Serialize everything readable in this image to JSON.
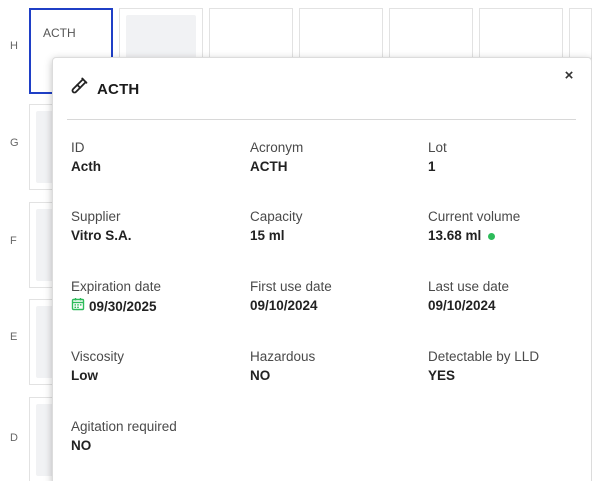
{
  "grid": {
    "row_labels": [
      "H",
      "G",
      "F",
      "E",
      "D"
    ],
    "selected_cell_label": "ACTH"
  },
  "popup": {
    "icon": "test-tube-icon",
    "title": "ACTH",
    "close_label": "×",
    "fields": {
      "id": {
        "label": "ID",
        "value": "Acth"
      },
      "acronym": {
        "label": "Acronym",
        "value": "ACTH"
      },
      "lot": {
        "label": "Lot",
        "value": "1"
      },
      "supplier": {
        "label": "Supplier",
        "value": "Vitro S.A."
      },
      "capacity": {
        "label": "Capacity",
        "value": "15 ml"
      },
      "current_volume": {
        "label": "Current volume",
        "value": "13.68 ml",
        "status_color": "#2dbb5a"
      },
      "expiration_date": {
        "label": "Expiration date",
        "value": "09/30/2025",
        "icon": "calendar-icon",
        "icon_color": "#2dbb5a"
      },
      "first_use_date": {
        "label": "First use date",
        "value": "09/10/2024"
      },
      "last_use_date": {
        "label": "Last use date",
        "value": "09/10/2024"
      },
      "viscosity": {
        "label": "Viscosity",
        "value": "Low"
      },
      "hazardous": {
        "label": "Hazardous",
        "value": "NO"
      },
      "detectable_lld": {
        "label": "Detectable by LLD",
        "value": "YES"
      },
      "agitation_required": {
        "label": "Agitation required",
        "value": "NO"
      }
    }
  },
  "colors": {
    "selection_border": "#1f3fc6",
    "status_ok": "#2dbb5a"
  }
}
